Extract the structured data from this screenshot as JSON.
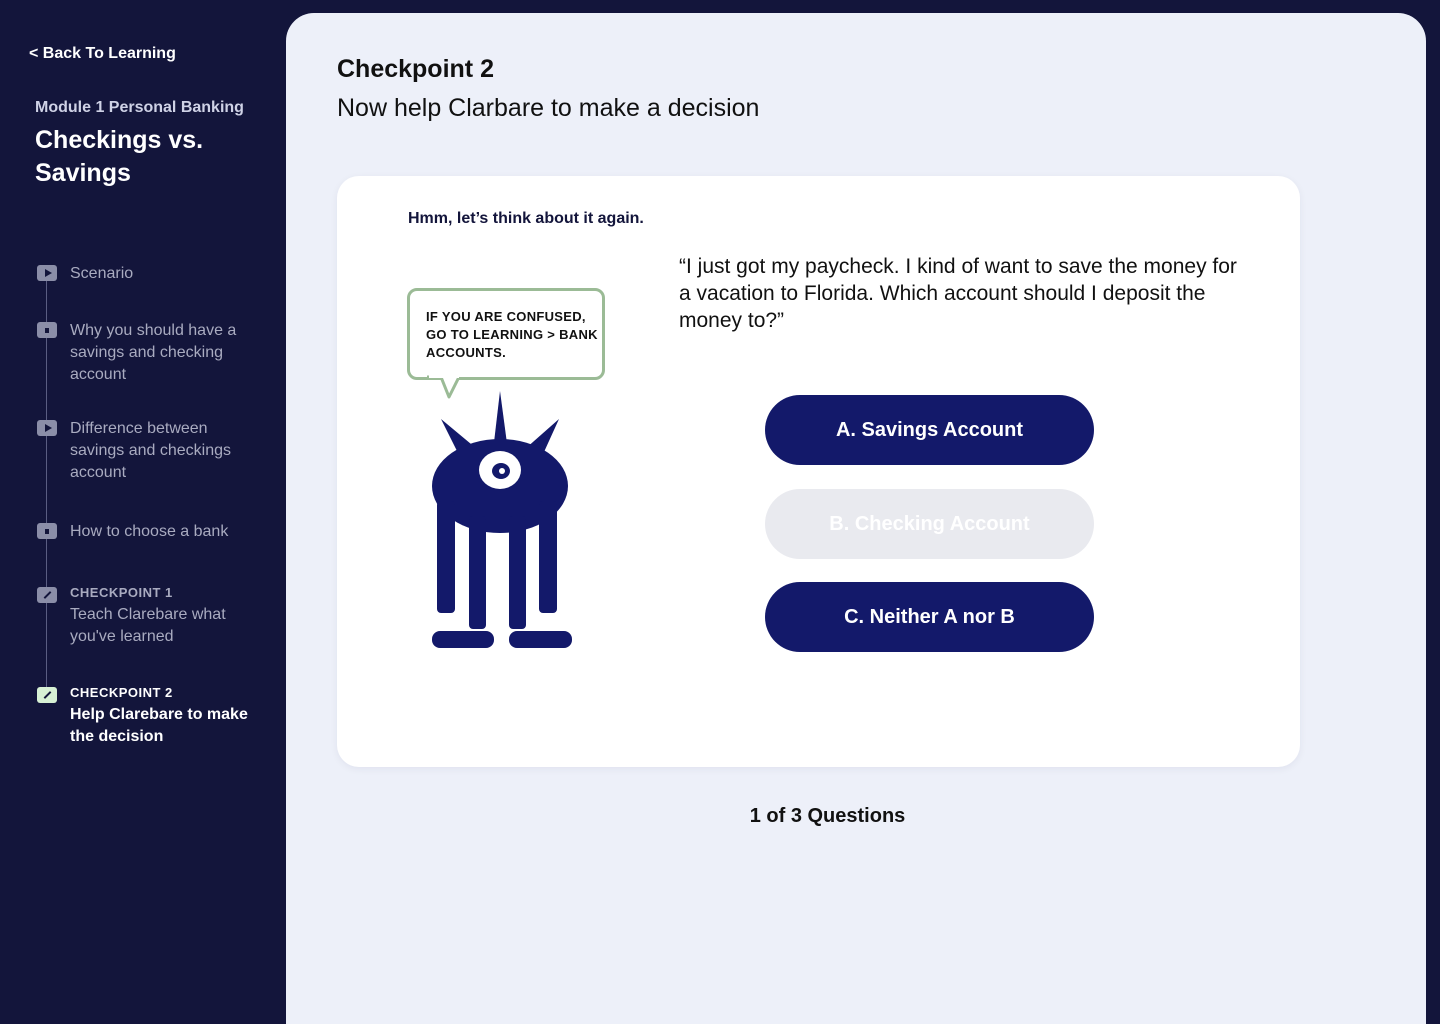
{
  "sidebar": {
    "back_link": "< Back To Learning",
    "module_label": "Module 1 Personal Banking",
    "module_title": "Checkings vs. Savings",
    "steps": [
      {
        "icon": "play-icon",
        "label": "Scenario"
      },
      {
        "icon": "document-icon",
        "label": "Why you should have a savings and checking account"
      },
      {
        "icon": "play-icon",
        "label": "Difference between savings and checkings account"
      },
      {
        "icon": "document-icon",
        "label": "How to choose a bank"
      },
      {
        "icon": "pencil-icon",
        "checkpoint": "CHECKPOINT 1",
        "label": "Teach Clarebare what you've learned"
      },
      {
        "icon": "pencil-icon",
        "checkpoint": "CHECKPOINT 2",
        "label": "Help Clarebare to make the decision",
        "active": true
      }
    ]
  },
  "main": {
    "title": "Checkpoint 2",
    "subtitle": "Now help Clarbare to make a decision",
    "card": {
      "hint": "Hmm, let’s think about it again.",
      "bubble": "IF YOU ARE CONFUSED, GO TO LEARNING > BANK ACCOUNTS.",
      "question": "“I just got my paycheck. I kind of want to save the money for a vacation to Florida. Which account should I deposit the money to?”",
      "answers": [
        {
          "label": "A. Savings Account",
          "disabled": false
        },
        {
          "label": "B. Checking Account",
          "disabled": true
        },
        {
          "label": "C. Neither A nor B",
          "disabled": false
        }
      ]
    },
    "progress": "1 of 3 Questions"
  },
  "colors": {
    "navy": "#13153b",
    "button": "#13196a",
    "panel": "#edf0f9",
    "bubble_border": "#9bbb96",
    "active_icon": "#d7f0d4"
  }
}
